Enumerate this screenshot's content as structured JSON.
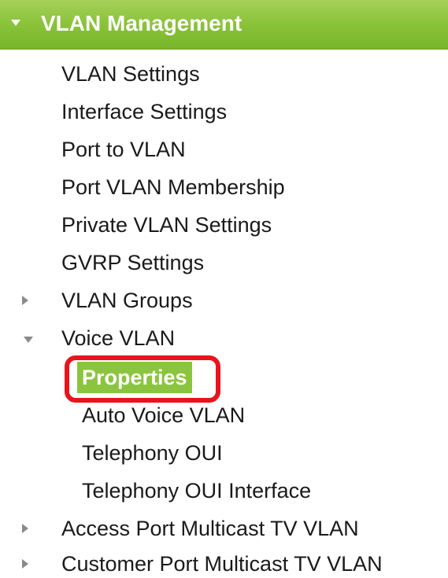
{
  "header": {
    "title": "VLAN Management"
  },
  "menu": {
    "vlan_settings": "VLAN Settings",
    "interface_settings": "Interface Settings",
    "port_to_vlan": "Port to VLAN",
    "port_vlan_membership": "Port VLAN Membership",
    "private_vlan_settings": "Private VLAN Settings",
    "gvrp_settings": "GVRP Settings",
    "vlan_groups": "VLAN Groups",
    "voice_vlan": "Voice VLAN",
    "voice_vlan_children": {
      "properties": "Properties",
      "auto_voice_vlan": "Auto Voice VLAN",
      "telephony_oui": "Telephony OUI",
      "telephony_oui_interface": "Telephony OUI Interface"
    },
    "access_port_multicast_tv_vlan": "Access Port Multicast TV VLAN",
    "customer_port_multicast_tv_vlan": "Customer Port Multicast TV VLAN"
  },
  "colors": {
    "header_green": "#8cc43c",
    "selected_green": "#8bc43f",
    "highlight_red": "#e8141c"
  },
  "icons": {
    "header": "caret-down-icon",
    "collapsed": "caret-right-icon",
    "expanded": "caret-down-icon"
  }
}
